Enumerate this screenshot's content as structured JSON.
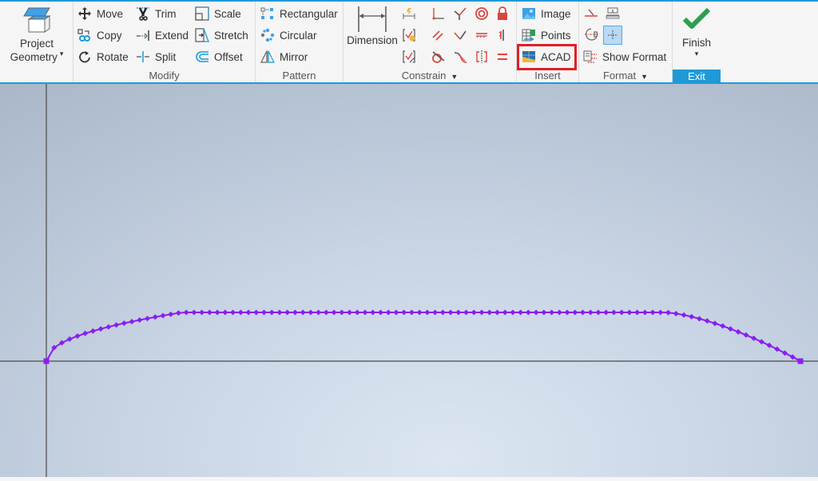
{
  "ribbon": {
    "project_geometry": {
      "label_line1": "Project",
      "label_line2": "Geometry",
      "icon": "project-geometry-icon"
    },
    "modify": {
      "label": "Modify",
      "items": [
        {
          "label": "Move",
          "icon": "move-icon"
        },
        {
          "label": "Copy",
          "icon": "copy-icon"
        },
        {
          "label": "Rotate",
          "icon": "rotate-icon"
        },
        {
          "label": "Trim",
          "icon": "trim-icon"
        },
        {
          "label": "Extend",
          "icon": "extend-icon"
        },
        {
          "label": "Split",
          "icon": "split-icon"
        },
        {
          "label": "Scale",
          "icon": "scale-icon"
        },
        {
          "label": "Stretch",
          "icon": "stretch-icon"
        },
        {
          "label": "Offset",
          "icon": "offset-icon"
        }
      ]
    },
    "pattern": {
      "label": "Pattern",
      "items": [
        {
          "label": "Rectangular",
          "icon": "rectangular-pattern-icon"
        },
        {
          "label": "Circular",
          "icon": "circular-pattern-icon"
        },
        {
          "label": "Mirror",
          "icon": "mirror-icon"
        }
      ]
    },
    "constrain": {
      "label": "Constrain",
      "dimension_label": "Dimension",
      "icons": [
        "auto-dimension-icon",
        "coincident-icon",
        "collinear-icon",
        "concentric-icon",
        "fix-icon",
        "constraint-inference-icon",
        "parallel-icon",
        "perpendicular-icon",
        "horizontal-icon",
        "vertical-icon",
        "constraint-persistence-icon",
        "tangent-icon",
        "smooth-icon",
        "symmetric-icon",
        "equal-icon"
      ]
    },
    "insert": {
      "label": "Insert",
      "items": [
        {
          "label": "Image",
          "icon": "image-icon"
        },
        {
          "label": "Points",
          "icon": "points-icon"
        },
        {
          "label": "ACAD",
          "icon": "acad-icon",
          "highlighted": true
        }
      ]
    },
    "format": {
      "label": "Format",
      "icons": [
        "construction-icon",
        "driven-dimension-icon",
        "centerline-icon",
        "center-point-icon"
      ],
      "show_format_label": "Show Format"
    },
    "exit": {
      "finish_label": "Finish",
      "label": "Exit"
    }
  },
  "colors": {
    "accent": "#1f9ad6",
    "curve": "#8a1ef0",
    "highlight": "#e01f26",
    "constraint": "#d9453f",
    "finish": "#2e9e4f"
  },
  "sketch": {
    "curve_type": "spline through imported points",
    "point_count": 98
  }
}
